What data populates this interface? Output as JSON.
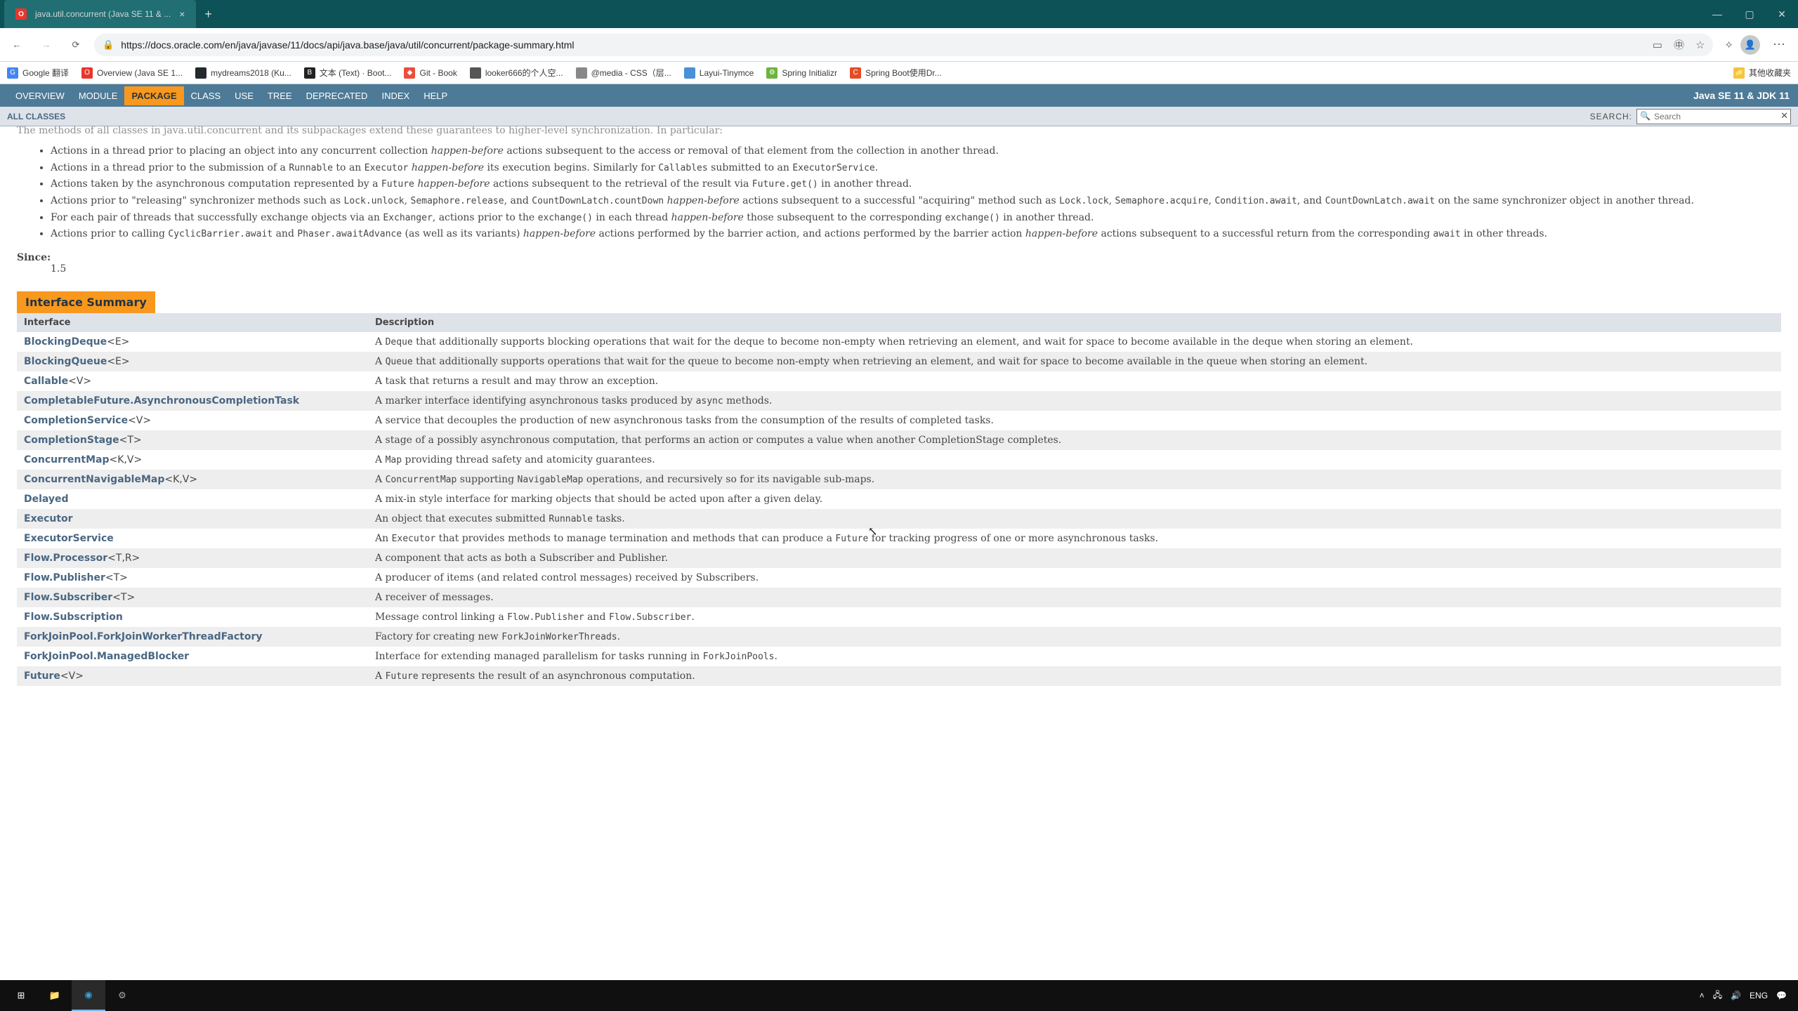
{
  "browser": {
    "tab_title": "java.util.concurrent (Java SE 11 & ...",
    "url": "https://docs.oracle.com/en/java/javase/11/docs/api/java.base/java/util/concurrent/package-summary.html"
  },
  "bookmarks": [
    {
      "icon_bg": "#4285f4",
      "icon_txt": "G",
      "label": "Google 翻译"
    },
    {
      "icon_bg": "#e8362d",
      "icon_txt": "O",
      "label": "Overview (Java SE 1..."
    },
    {
      "icon_bg": "#24292e",
      "icon_txt": "",
      "label": "mydreams2018 (Ku..."
    },
    {
      "icon_bg": "#222",
      "icon_txt": "B",
      "label": "文本 (Text) · Boot..."
    },
    {
      "icon_bg": "#eb4d3d",
      "icon_txt": "◆",
      "label": "Git - Book"
    },
    {
      "icon_bg": "#555",
      "icon_txt": "",
      "label": "looker666的个人空..."
    },
    {
      "icon_bg": "#888",
      "icon_txt": "",
      "label": "@media - CSS（层..."
    },
    {
      "icon_bg": "#4a90d9",
      "icon_txt": "",
      "label": "Layui-Tinymce"
    },
    {
      "icon_bg": "#6db33f",
      "icon_txt": "⚙",
      "label": "Spring Initializr"
    },
    {
      "icon_bg": "#e34c26",
      "icon_txt": "C",
      "label": "Spring Boot使用Dr..."
    }
  ],
  "other_bookmarks": "其他收藏夹",
  "java_nav": {
    "items": [
      "OVERVIEW",
      "MODULE",
      "PACKAGE",
      "CLASS",
      "USE",
      "TREE",
      "DEPRECATED",
      "INDEX",
      "HELP"
    ],
    "active": "PACKAGE",
    "version": "Java SE 11 & JDK 11"
  },
  "subnav": {
    "all_classes": "ALL CLASSES",
    "search_label": "SEARCH:",
    "search_placeholder": "Search"
  },
  "intro_line": "The methods of all classes in java.util.concurrent and its subpackages extend these guarantees to higher-level synchronization. In particular:",
  "bullets": [
    {
      "text": "Actions in a thread prior to placing an object into any concurrent collection <i>happen-before</i> actions subsequent to the access or removal of that element from the collection in another thread."
    },
    {
      "text": "Actions in a thread prior to the submission of a <code>Runnable</code> to an <code>Executor</code> <i>happen-before</i> its execution begins. Similarly for <code>Callables</code> submitted to an <code>ExecutorService</code>."
    },
    {
      "text": "Actions taken by the asynchronous computation represented by a <code>Future</code> <i>happen-before</i> actions subsequent to the retrieval of the result via <code>Future.get()</code> in another thread."
    },
    {
      "text": "Actions prior to \"releasing\" synchronizer methods such as <code>Lock.unlock</code>, <code>Semaphore.release</code>, and <code>CountDownLatch.countDown</code> <i>happen-before</i> actions subsequent to a successful \"acquiring\" method such as <code>Lock.lock</code>, <code>Semaphore.acquire</code>, <code>Condition.await</code>, and <code>CountDownLatch.await</code> on the same synchronizer object in another thread."
    },
    {
      "text": "For each pair of threads that successfully exchange objects via an <code>Exchanger</code>, actions prior to the <code>exchange()</code> in each thread <i>happen-before</i> those subsequent to the corresponding <code>exchange()</code> in another thread."
    },
    {
      "text": "Actions prior to calling <code>CyclicBarrier.await</code> and <code>Phaser.awaitAdvance</code> (as well as its variants) <i>happen-before</i> actions performed by the barrier action, and actions performed by the barrier action <i>happen-before</i> actions subsequent to a successful return from the corresponding <code>await</code> in other threads."
    }
  ],
  "since": {
    "label": "Since:",
    "value": "1.5"
  },
  "table_title": "Interface Summary",
  "table_headers": {
    "iface": "Interface",
    "desc": "Description"
  },
  "interfaces": [
    {
      "name": "BlockingDeque",
      "params": "<E>",
      "desc": "A <code>Deque</code> that additionally supports blocking operations that wait for the deque to become non-empty when retrieving an element, and wait for space to become available in the deque when storing an element."
    },
    {
      "name": "BlockingQueue",
      "params": "<E>",
      "desc": "A <code>Queue</code> that additionally supports operations that wait for the queue to become non-empty when retrieving an element, and wait for space to become available in the queue when storing an element."
    },
    {
      "name": "Callable",
      "params": "<V>",
      "desc": "A task that returns a result and may throw an exception."
    },
    {
      "name": "CompletableFuture.AsynchronousCompletionTask",
      "params": "",
      "desc": "A marker interface identifying asynchronous tasks produced by <code>async</code> methods."
    },
    {
      "name": "CompletionService",
      "params": "<V>",
      "desc": "A service that decouples the production of new asynchronous tasks from the consumption of the results of completed tasks."
    },
    {
      "name": "CompletionStage",
      "params": "<T>",
      "desc": "A stage of a possibly asynchronous computation, that performs an action or computes a value when another CompletionStage completes."
    },
    {
      "name": "ConcurrentMap",
      "params": "<K,V>",
      "desc": "A <code>Map</code> providing thread safety and atomicity guarantees."
    },
    {
      "name": "ConcurrentNavigableMap",
      "params": "<K,V>",
      "desc": "A <code>ConcurrentMap</code> supporting <code>NavigableMap</code> operations, and recursively so for its navigable sub-maps."
    },
    {
      "name": "Delayed",
      "params": "",
      "desc": "A mix-in style interface for marking objects that should be acted upon after a given delay."
    },
    {
      "name": "Executor",
      "params": "",
      "desc": "An object that executes submitted <code>Runnable</code> tasks."
    },
    {
      "name": "ExecutorService",
      "params": "",
      "desc": "An <code>Executor</code> that provides methods to manage termination and methods that can produce a <code>Future</code> for tracking progress of one or more asynchronous tasks."
    },
    {
      "name": "Flow.Processor",
      "params": "<T,R>",
      "desc": "A component that acts as both a Subscriber and Publisher."
    },
    {
      "name": "Flow.Publisher",
      "params": "<T>",
      "desc": "A producer of items (and related control messages) received by Subscribers."
    },
    {
      "name": "Flow.Subscriber",
      "params": "<T>",
      "desc": "A receiver of messages."
    },
    {
      "name": "Flow.Subscription",
      "params": "",
      "desc": "Message control linking a <code>Flow.Publisher</code> and <code>Flow.Subscriber</code>."
    },
    {
      "name": "ForkJoinPool.ForkJoinWorkerThreadFactory",
      "params": "",
      "desc": "Factory for creating new <code>ForkJoinWorkerThreads</code>."
    },
    {
      "name": "ForkJoinPool.ManagedBlocker",
      "params": "",
      "desc": "Interface for extending managed parallelism for tasks running in <code>ForkJoinPools</code>."
    },
    {
      "name": "Future",
      "params": "<V>",
      "desc": "A <code>Future</code> represents the result of an asynchronous computation."
    }
  ],
  "taskbar": {
    "lang": "ENG"
  }
}
